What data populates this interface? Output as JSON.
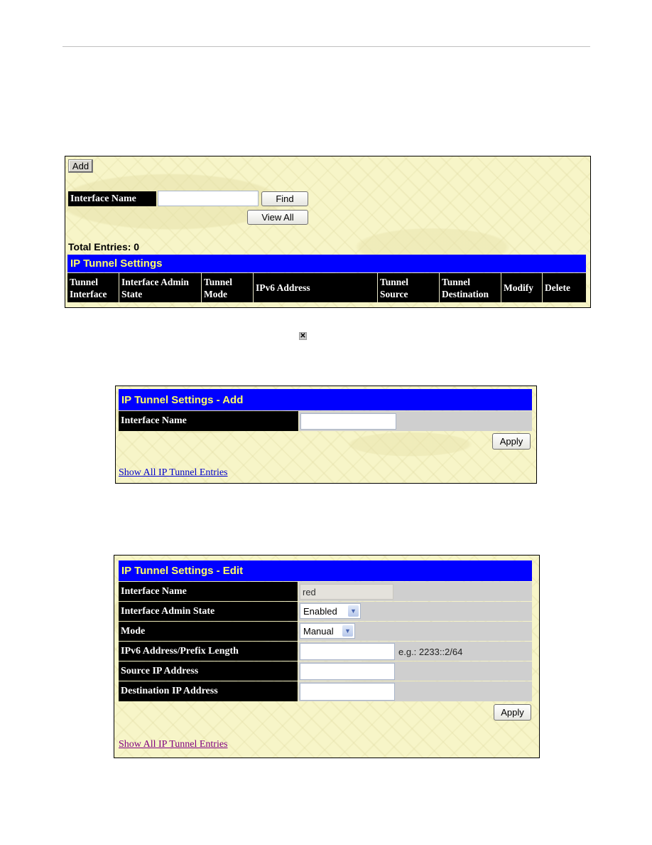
{
  "list_panel": {
    "add_button": "Add",
    "interface_name_label": "Interface Name",
    "interface_name_value": "",
    "find_button": "Find",
    "view_all_button": "View All",
    "total_entries": "Total Entries: 0",
    "table_title": "IP Tunnel Settings",
    "columns": [
      "Tunnel Interface",
      "Interface Admin State",
      "Tunnel Mode",
      "IPv6 Address",
      "Tunnel Source",
      "Tunnel Destination",
      "Modify",
      "Delete"
    ],
    "columns_split": [
      [
        "Tunnel",
        "Interface"
      ],
      [
        "Interface Admin",
        "State"
      ],
      [
        "Tunnel",
        "Mode"
      ],
      [
        "IPv6 Address"
      ],
      [
        "Tunnel",
        "Source"
      ],
      [
        "Tunnel",
        "Destination"
      ],
      [
        "Modify"
      ],
      [
        "Delete"
      ]
    ],
    "rows": []
  },
  "delete_icon": {
    "glyph": "✕",
    "name": "delete-x-icon"
  },
  "add_panel": {
    "title": "IP Tunnel Settings - Add",
    "interface_name_label": "Interface Name",
    "interface_name_value": "",
    "apply_button": "Apply",
    "show_all_link": "Show All IP Tunnel Entries",
    "link_color": "#0000cc"
  },
  "edit_panel": {
    "title": "IP Tunnel Settings - Edit",
    "fields": {
      "interface_name": {
        "label": "Interface Name",
        "value": "red"
      },
      "admin_state": {
        "label": "Interface Admin State",
        "value": "Enabled"
      },
      "mode": {
        "label": "Mode",
        "value": "Manual"
      },
      "ipv6_prefix": {
        "label": "IPv6 Address/Prefix Length",
        "value": "",
        "hint": "e.g.: 2233::2/64"
      },
      "source_ip": {
        "label": "Source IP Address",
        "value": ""
      },
      "destination_ip": {
        "label": "Destination IP Address",
        "value": ""
      }
    },
    "apply_button": "Apply",
    "show_all_link": "Show All IP Tunnel Entries",
    "link_color": "#800080"
  },
  "colors": {
    "title_bar_bg": "#0000ff",
    "title_bar_text": "#ffff66",
    "panel_bg": "#f7f5c8",
    "label_bg": "#000000"
  }
}
